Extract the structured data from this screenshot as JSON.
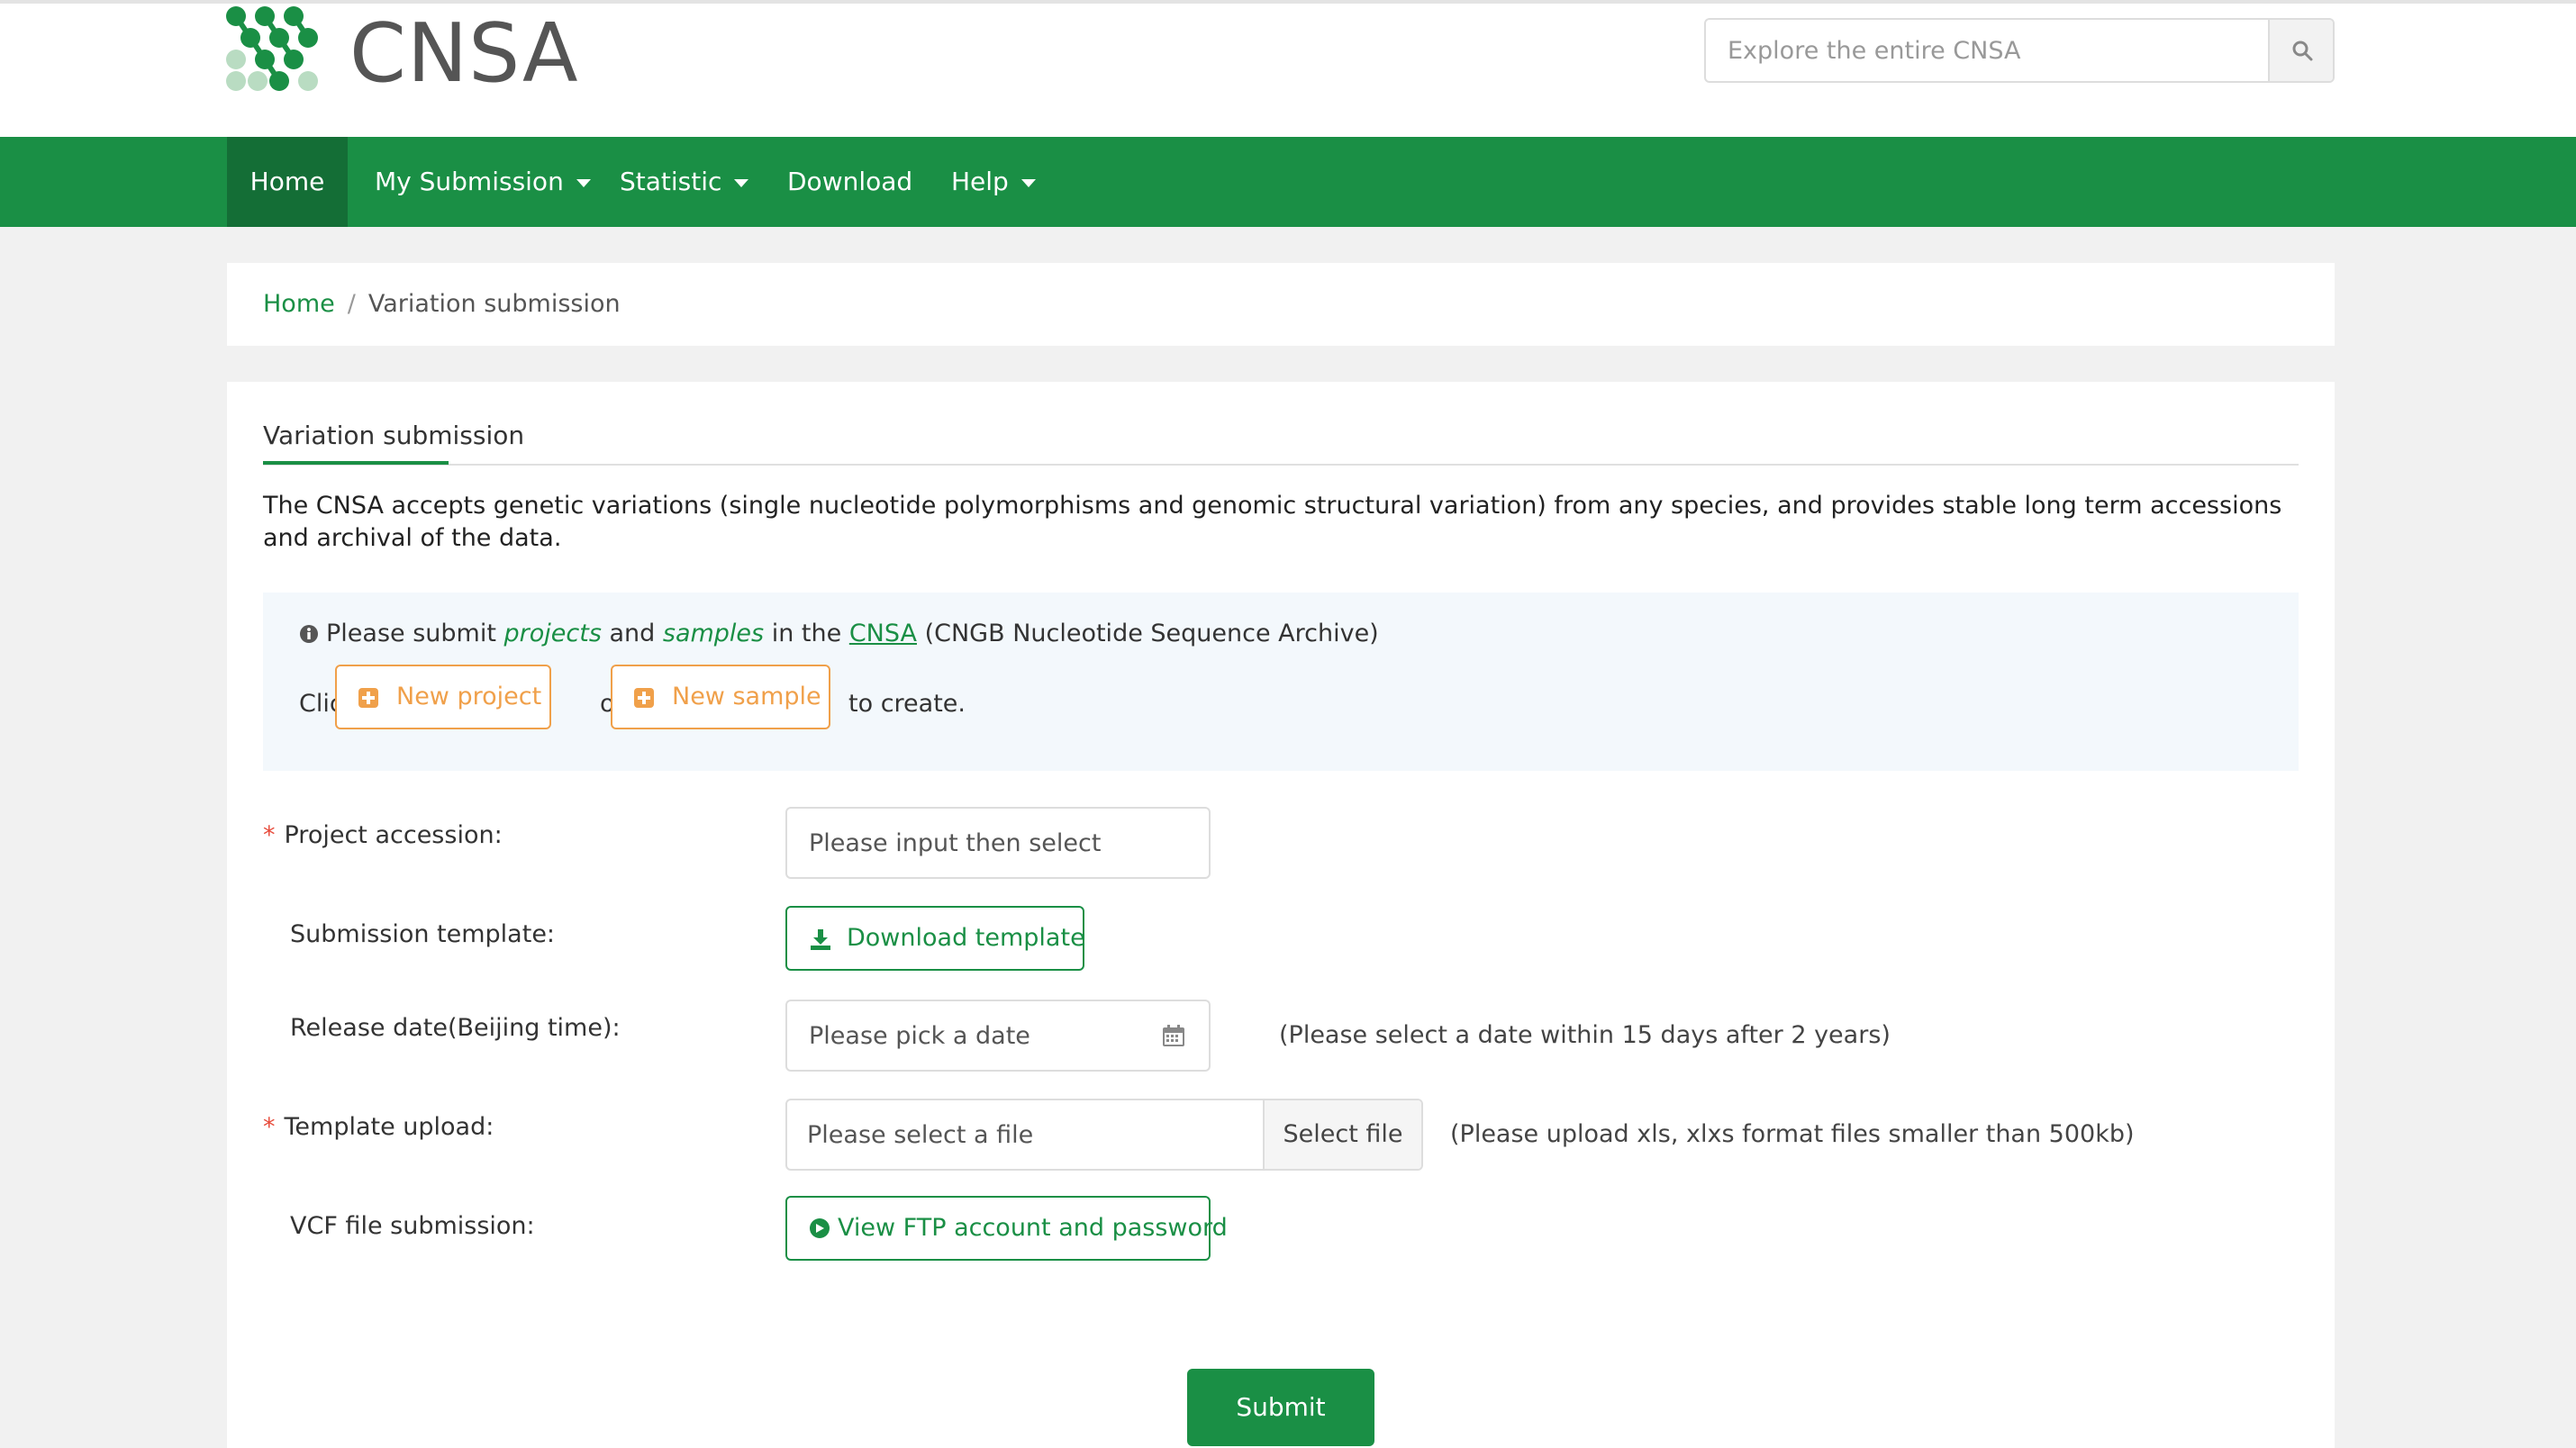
{
  "header": {
    "logo_text": "CNSA",
    "search": {
      "placeholder": "Explore the entire CNSA",
      "value": ""
    }
  },
  "nav": {
    "items": [
      {
        "label": "Home",
        "active": true,
        "dropdown": false
      },
      {
        "label": "My Submission",
        "active": false,
        "dropdown": true
      },
      {
        "label": "Statistic",
        "active": false,
        "dropdown": true
      },
      {
        "label": "Download",
        "active": false,
        "dropdown": false
      },
      {
        "label": "Help",
        "active": false,
        "dropdown": true
      }
    ]
  },
  "breadcrumb": {
    "home": "Home",
    "separator": "/",
    "current": "Variation submission"
  },
  "main": {
    "tab_title": "Variation submission",
    "intro": "The CNSA accepts genetic variations (single nucleotide polymorphisms and genomic structural variation) from any species, and provides stable long term accessions and archival of the data.",
    "notice": {
      "prefix": "Please submit",
      "projects": "projects",
      "and": "and",
      "samples": "samples",
      "in_the": "in the",
      "cnsa_link": "CNSA",
      "suffix": "(CNGB Nucleotide Sequence Archive)",
      "click": "Click",
      "new_project": "New project",
      "or": "or",
      "new_sample": "New sample",
      "to_create": "to create."
    },
    "form": {
      "required_mark": "*",
      "project_accession": {
        "label": "Project accession:",
        "placeholder": "Please input then select",
        "value": ""
      },
      "submission_template": {
        "label": "Submission template:",
        "button": "Download template"
      },
      "release_date": {
        "label": "Release date(Beijing time):",
        "placeholder": "Please pick a date",
        "value": "",
        "hint": "(Please select a date within 15 days after 2 years)"
      },
      "template_upload": {
        "label": "Template upload:",
        "placeholder": "Please select a file",
        "value": "",
        "button": "Select file",
        "hint": "(Please upload xls, xlxs format files smaller than 500kb)"
      },
      "vcf_submission": {
        "label": "VCF file submission:",
        "button": "View FTP account and password"
      },
      "submit": "Submit"
    }
  },
  "colors": {
    "brand_green": "#1a8f45",
    "nav_active": "#146e36",
    "accent_orange": "#f0a04a",
    "required_red": "#e74c3c",
    "notice_bg": "#f3f8fc",
    "page_bg": "#f1f1f1"
  }
}
